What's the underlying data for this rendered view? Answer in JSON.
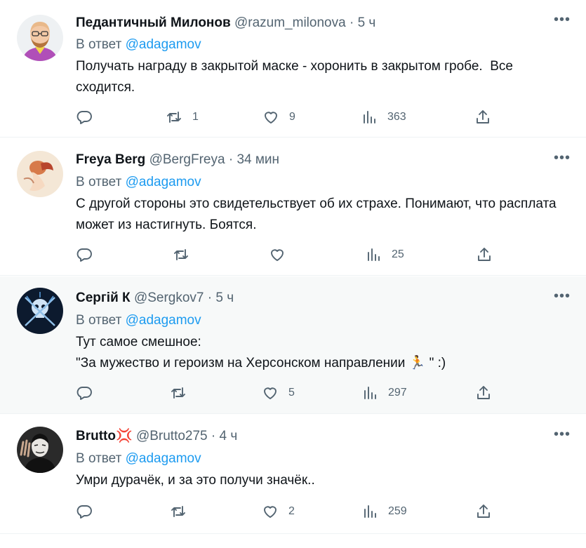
{
  "colors": {
    "link": "#1d9bf0",
    "muted": "#536471",
    "text": "#0f1419",
    "shaded_bg": "#f7f9f9"
  },
  "tweets": [
    {
      "name": "Педантичный Милонов",
      "handle": "@razum_milonova",
      "sep": "·",
      "time": "5 ч",
      "reply_prefix": "В ответ",
      "reply_mention": "@adagamov",
      "text": "Получать награду в закрытой маске - хоронить в закрытом гробе.  Все сходится.",
      "replies": "",
      "retweets": "1",
      "likes": "9",
      "views": "363",
      "avatar_icon": "avatar-cartoon-face"
    },
    {
      "name": "Freya Berg",
      "handle": "@BergFreya",
      "sep": "·",
      "time": "34 мин",
      "reply_prefix": "В ответ",
      "reply_mention": "@adagamov",
      "text": "С другой стороны это свидетельствует об их страхе. Понимают, что расплата может из настигнуть. Боятся.",
      "replies": "",
      "retweets": "",
      "likes": "",
      "views": "25",
      "avatar_icon": "avatar-painting"
    },
    {
      "name": "Сергій К",
      "handle": "@Sergkov7",
      "sep": "·",
      "time": "5 ч",
      "reply_prefix": "В ответ",
      "reply_mention": "@adagamov",
      "text": "Тут самое смешное:\n\"За мужество и героизм на Херсонском направлении 🏃 \" :)",
      "replies": "",
      "retweets": "",
      "likes": "5",
      "views": "297",
      "avatar_icon": "avatar-skull-swords"
    },
    {
      "name": "Brutto",
      "name_badge": "💢",
      "handle": "@Brutto275",
      "sep": "·",
      "time": "4 ч",
      "reply_prefix": "В ответ",
      "reply_mention": "@adagamov",
      "text": "Умри дурачёк, и за это получи значёк..",
      "replies": "",
      "retweets": "",
      "likes": "2",
      "views": "259",
      "avatar_icon": "avatar-masked-person"
    }
  ]
}
